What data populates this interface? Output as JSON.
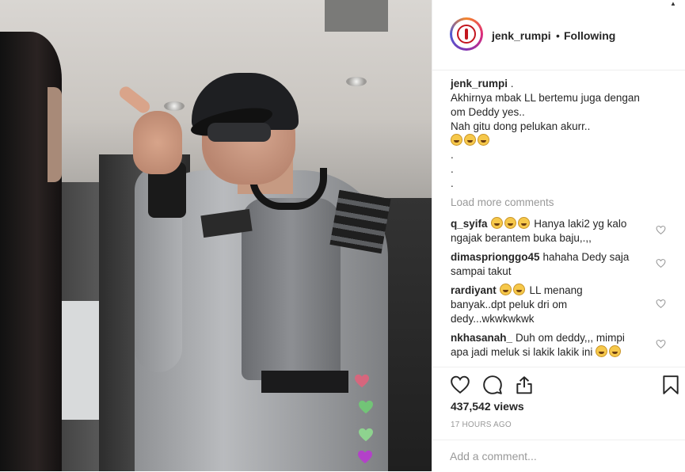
{
  "post": {
    "username": "jenk_rumpi",
    "separator": "•",
    "follow_status": "Following"
  },
  "caption": {
    "username": "jenk_rumpi",
    "suffix": " .",
    "lines": [
      "Akhirnya mbak LL bertemu juga dengan",
      "om Deddy yes..",
      "Nah gitu dong pelukan akurr.."
    ],
    "dots": [
      ".",
      ".",
      "."
    ]
  },
  "load_more_label": "Load more comments",
  "comments": [
    {
      "user": "q_syifa",
      "lines": [
        "Hanya laki2 yg kalo",
        "ngajak berantem buka baju,.,,"
      ]
    },
    {
      "user": "dimasprionggo45",
      "lines": [
        "hahaha Dedy saja",
        "sampai takut"
      ]
    },
    {
      "user": "rardiyant",
      "lines": [
        "LL menang",
        "banyak..dpt peluk dri om",
        "dedy...wkwkwkwk"
      ]
    },
    {
      "user": "nkhasanah_",
      "lines": [
        "Duh om deddy,,, mimpi",
        "apa jadi meluk si lakik lakik ini"
      ]
    }
  ],
  "views": "437,542 views",
  "timestamp": "17 HOURS AGO",
  "add_comment_placeholder": "Add a comment...",
  "icons": {
    "like": "heart-outline-icon",
    "comment": "comment-bubble-icon",
    "share": "share-icon",
    "save": "bookmark-icon",
    "comment_like": "small-heart-icon",
    "emoji": "grinning-face-emoji"
  },
  "colors": {
    "text": "#262626",
    "muted": "#999999",
    "border": "#efefef",
    "avatar_logo": "#c3161f"
  }
}
